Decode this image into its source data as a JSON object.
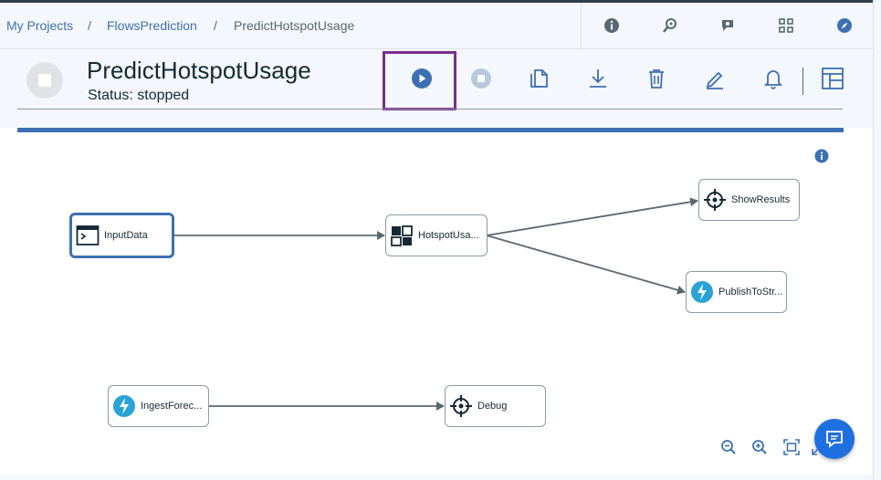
{
  "breadcrumb": {
    "items": [
      "My Projects",
      "FlowsPrediction",
      "PredictHotspotUsage"
    ],
    "separator": "/"
  },
  "top_icons": [
    "info-icon",
    "search-location-icon",
    "chat-search-icon",
    "apps-grid-icon",
    "compass-icon"
  ],
  "flow": {
    "title": "PredictHotspotUsage",
    "status": "Status: stopped"
  },
  "toolbar": {
    "buttons": [
      "run-icon",
      "stop-icon",
      "copy-icon",
      "download-icon",
      "delete-icon",
      "edit-icon",
      "notifications-icon",
      "layout-panel-icon"
    ]
  },
  "canvas": {
    "nodes": [
      {
        "label": "InputData",
        "icon": "terminal-icon",
        "selected": true
      },
      {
        "label": "HotspotUsa...",
        "icon": "model-icon",
        "selected": false
      },
      {
        "label": "ShowResults",
        "icon": "crosshair-icon",
        "selected": false
      },
      {
        "label": "PublishToStr...",
        "icon": "lightning-icon",
        "selected": false
      },
      {
        "label": "IngestForec...",
        "icon": "lightning-icon",
        "selected": false
      },
      {
        "label": "Debug",
        "icon": "crosshair-icon",
        "selected": false
      }
    ],
    "zoom_controls": [
      "zoom-out-icon",
      "zoom-in-icon",
      "fit-to-screen-icon",
      "expand-icon"
    ]
  },
  "colors": {
    "accent": "#3d70b2",
    "highlight": "#7b2d8f",
    "chat_button": "#1f6fe0"
  }
}
